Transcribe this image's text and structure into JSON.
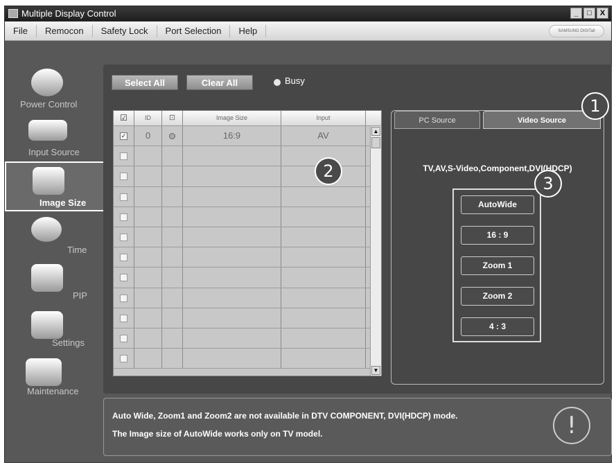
{
  "window": {
    "title": "Multiple Display Control",
    "controls": [
      "_",
      "□",
      "X"
    ]
  },
  "menu": {
    "items": [
      "File",
      "Remocon",
      "Safety Lock",
      "Port Selection",
      "Help"
    ],
    "brand": "SAMSUNG DIGITall"
  },
  "sidebar": {
    "items": [
      {
        "label": "Power Control",
        "icon": "power-icon"
      },
      {
        "label": "Input Source",
        "icon": "input-source-icon"
      },
      {
        "label": "Image Size",
        "icon": "image-size-icon",
        "selected": true
      },
      {
        "label": "Time",
        "icon": "clock-icon"
      },
      {
        "label": "PIP",
        "icon": "pip-icon"
      },
      {
        "label": "Settings",
        "icon": "settings-icon"
      },
      {
        "label": "Maintenance",
        "icon": "maintenance-icon"
      }
    ]
  },
  "toolbar": {
    "select_all": "Select All",
    "clear_all": "Clear All",
    "busy": "Busy"
  },
  "grid": {
    "headers": {
      "check": "☑",
      "id": "ID",
      "power": "⊡",
      "image_size": "Image Size",
      "input": "Input"
    },
    "rows": [
      {
        "checked": true,
        "id": "0",
        "power": "●",
        "image_size": "16:9",
        "input": "AV"
      }
    ],
    "empty_rows": 11
  },
  "tabs": {
    "pc_source": "PC Source",
    "video_source": "Video Source"
  },
  "source_list": "TV,AV,S-Video,Component,DVI(HDCP)",
  "size_buttons": [
    "AutoWide",
    "16 : 9",
    "Zoom 1",
    "Zoom 2",
    "4 : 3"
  ],
  "callouts": [
    "1",
    "2",
    "3"
  ],
  "notice": {
    "line1": "Auto Wide, Zoom1 and Zoom2 are not available in DTV COMPONENT, DVI(HDCP) mode.",
    "line2": "The Image size of AutoWide works only on TV model."
  }
}
